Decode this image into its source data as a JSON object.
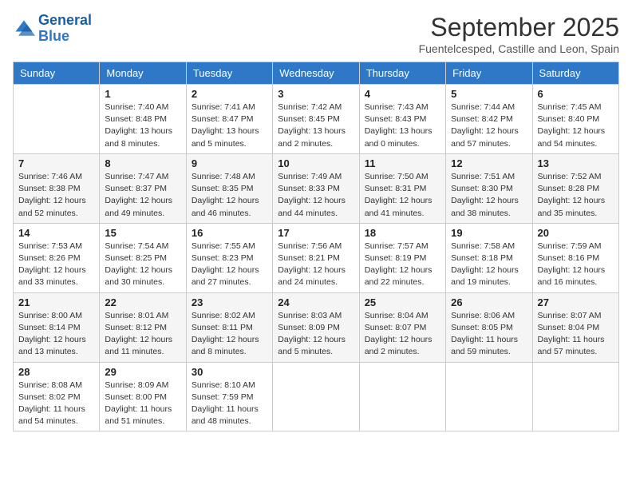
{
  "header": {
    "logo_general": "General",
    "logo_blue": "Blue",
    "month_year": "September 2025",
    "location": "Fuentelcesped, Castille and Leon, Spain"
  },
  "days_of_week": [
    "Sunday",
    "Monday",
    "Tuesday",
    "Wednesday",
    "Thursday",
    "Friday",
    "Saturday"
  ],
  "weeks": [
    [
      {
        "num": "",
        "info": ""
      },
      {
        "num": "1",
        "info": "Sunrise: 7:40 AM\nSunset: 8:48 PM\nDaylight: 13 hours\nand 8 minutes."
      },
      {
        "num": "2",
        "info": "Sunrise: 7:41 AM\nSunset: 8:47 PM\nDaylight: 13 hours\nand 5 minutes."
      },
      {
        "num": "3",
        "info": "Sunrise: 7:42 AM\nSunset: 8:45 PM\nDaylight: 13 hours\nand 2 minutes."
      },
      {
        "num": "4",
        "info": "Sunrise: 7:43 AM\nSunset: 8:43 PM\nDaylight: 13 hours\nand 0 minutes."
      },
      {
        "num": "5",
        "info": "Sunrise: 7:44 AM\nSunset: 8:42 PM\nDaylight: 12 hours\nand 57 minutes."
      },
      {
        "num": "6",
        "info": "Sunrise: 7:45 AM\nSunset: 8:40 PM\nDaylight: 12 hours\nand 54 minutes."
      }
    ],
    [
      {
        "num": "7",
        "info": "Sunrise: 7:46 AM\nSunset: 8:38 PM\nDaylight: 12 hours\nand 52 minutes."
      },
      {
        "num": "8",
        "info": "Sunrise: 7:47 AM\nSunset: 8:37 PM\nDaylight: 12 hours\nand 49 minutes."
      },
      {
        "num": "9",
        "info": "Sunrise: 7:48 AM\nSunset: 8:35 PM\nDaylight: 12 hours\nand 46 minutes."
      },
      {
        "num": "10",
        "info": "Sunrise: 7:49 AM\nSunset: 8:33 PM\nDaylight: 12 hours\nand 44 minutes."
      },
      {
        "num": "11",
        "info": "Sunrise: 7:50 AM\nSunset: 8:31 PM\nDaylight: 12 hours\nand 41 minutes."
      },
      {
        "num": "12",
        "info": "Sunrise: 7:51 AM\nSunset: 8:30 PM\nDaylight: 12 hours\nand 38 minutes."
      },
      {
        "num": "13",
        "info": "Sunrise: 7:52 AM\nSunset: 8:28 PM\nDaylight: 12 hours\nand 35 minutes."
      }
    ],
    [
      {
        "num": "14",
        "info": "Sunrise: 7:53 AM\nSunset: 8:26 PM\nDaylight: 12 hours\nand 33 minutes."
      },
      {
        "num": "15",
        "info": "Sunrise: 7:54 AM\nSunset: 8:25 PM\nDaylight: 12 hours\nand 30 minutes."
      },
      {
        "num": "16",
        "info": "Sunrise: 7:55 AM\nSunset: 8:23 PM\nDaylight: 12 hours\nand 27 minutes."
      },
      {
        "num": "17",
        "info": "Sunrise: 7:56 AM\nSunset: 8:21 PM\nDaylight: 12 hours\nand 24 minutes."
      },
      {
        "num": "18",
        "info": "Sunrise: 7:57 AM\nSunset: 8:19 PM\nDaylight: 12 hours\nand 22 minutes."
      },
      {
        "num": "19",
        "info": "Sunrise: 7:58 AM\nSunset: 8:18 PM\nDaylight: 12 hours\nand 19 minutes."
      },
      {
        "num": "20",
        "info": "Sunrise: 7:59 AM\nSunset: 8:16 PM\nDaylight: 12 hours\nand 16 minutes."
      }
    ],
    [
      {
        "num": "21",
        "info": "Sunrise: 8:00 AM\nSunset: 8:14 PM\nDaylight: 12 hours\nand 13 minutes."
      },
      {
        "num": "22",
        "info": "Sunrise: 8:01 AM\nSunset: 8:12 PM\nDaylight: 12 hours\nand 11 minutes."
      },
      {
        "num": "23",
        "info": "Sunrise: 8:02 AM\nSunset: 8:11 PM\nDaylight: 12 hours\nand 8 minutes."
      },
      {
        "num": "24",
        "info": "Sunrise: 8:03 AM\nSunset: 8:09 PM\nDaylight: 12 hours\nand 5 minutes."
      },
      {
        "num": "25",
        "info": "Sunrise: 8:04 AM\nSunset: 8:07 PM\nDaylight: 12 hours\nand 2 minutes."
      },
      {
        "num": "26",
        "info": "Sunrise: 8:06 AM\nSunset: 8:05 PM\nDaylight: 11 hours\nand 59 minutes."
      },
      {
        "num": "27",
        "info": "Sunrise: 8:07 AM\nSunset: 8:04 PM\nDaylight: 11 hours\nand 57 minutes."
      }
    ],
    [
      {
        "num": "28",
        "info": "Sunrise: 8:08 AM\nSunset: 8:02 PM\nDaylight: 11 hours\nand 54 minutes."
      },
      {
        "num": "29",
        "info": "Sunrise: 8:09 AM\nSunset: 8:00 PM\nDaylight: 11 hours\nand 51 minutes."
      },
      {
        "num": "30",
        "info": "Sunrise: 8:10 AM\nSunset: 7:59 PM\nDaylight: 11 hours\nand 48 minutes."
      },
      {
        "num": "",
        "info": ""
      },
      {
        "num": "",
        "info": ""
      },
      {
        "num": "",
        "info": ""
      },
      {
        "num": "",
        "info": ""
      }
    ]
  ]
}
